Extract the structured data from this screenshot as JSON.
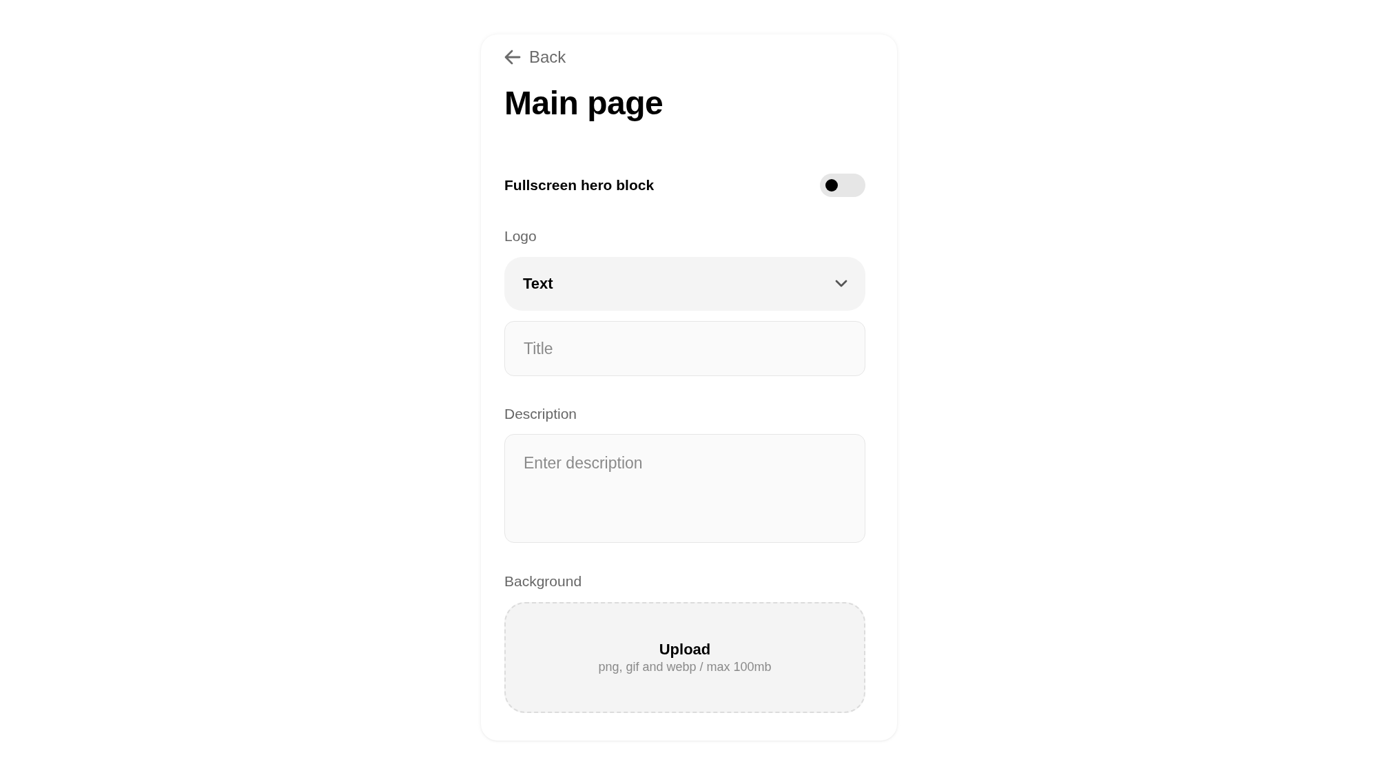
{
  "back_link": {
    "label": "Back"
  },
  "title": "Main page",
  "hero_toggle": {
    "label": "Fullscreen hero block",
    "on": false
  },
  "logo": {
    "label": "Logo",
    "select": {
      "value": "Text"
    },
    "title_field": {
      "placeholder": "Title"
    }
  },
  "description": {
    "label": "Description",
    "placeholder": "Enter description"
  },
  "background": {
    "label": "Background",
    "upload": {
      "title": "Upload",
      "hint": "png, gif and webp / max 100mb"
    }
  }
}
